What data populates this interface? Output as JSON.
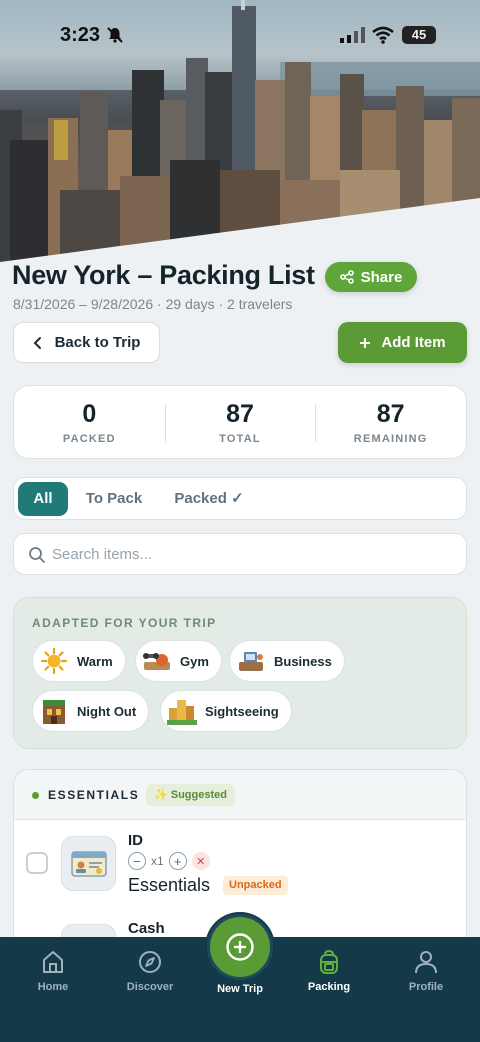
{
  "status_bar": {
    "time": "3:23",
    "battery": "45"
  },
  "header": {
    "title": "New York – Packing List",
    "share_label": "Share",
    "subtitle": "8/31/2026 – 9/28/2026 · 29 days · 2 travelers",
    "back_label": "Back to Trip",
    "add_label": "Add Item"
  },
  "stats": [
    {
      "value": "0",
      "label": "PACKED"
    },
    {
      "value": "87",
      "label": "TOTAL"
    },
    {
      "value": "87",
      "label": "REMAINING"
    }
  ],
  "tabs": {
    "all": "All",
    "to_pack": "To Pack",
    "packed": "Packed ✓"
  },
  "search": {
    "placeholder": "Search items..."
  },
  "adapted": {
    "title": "ADAPTED FOR YOUR TRIP",
    "chips": [
      {
        "label": "Warm",
        "icon": "sun-icon"
      },
      {
        "label": "Gym",
        "icon": "gym-icon"
      },
      {
        "label": "Business",
        "icon": "business-icon"
      },
      {
        "label": "Night Out",
        "icon": "night-out-icon"
      },
      {
        "label": "Sightseeing",
        "icon": "sightseeing-icon"
      }
    ]
  },
  "essentials": {
    "title": "ESSENTIALS",
    "badge": "✨ Suggested",
    "items": [
      {
        "name": "ID",
        "qty": "x1",
        "category": "Essentials",
        "status": "Unpacked",
        "icon": "id-card-icon"
      },
      {
        "name": "Cash"
      }
    ]
  },
  "nav": {
    "home": "Home",
    "discover": "Discover",
    "new_trip": "New Trip",
    "packing": "Packing",
    "profile": "Profile"
  },
  "colors": {
    "primary_green": "#5a9b36",
    "teal": "#1f7a78",
    "nav_bg": "#143a4a",
    "unpacked": "#d86a1a"
  }
}
